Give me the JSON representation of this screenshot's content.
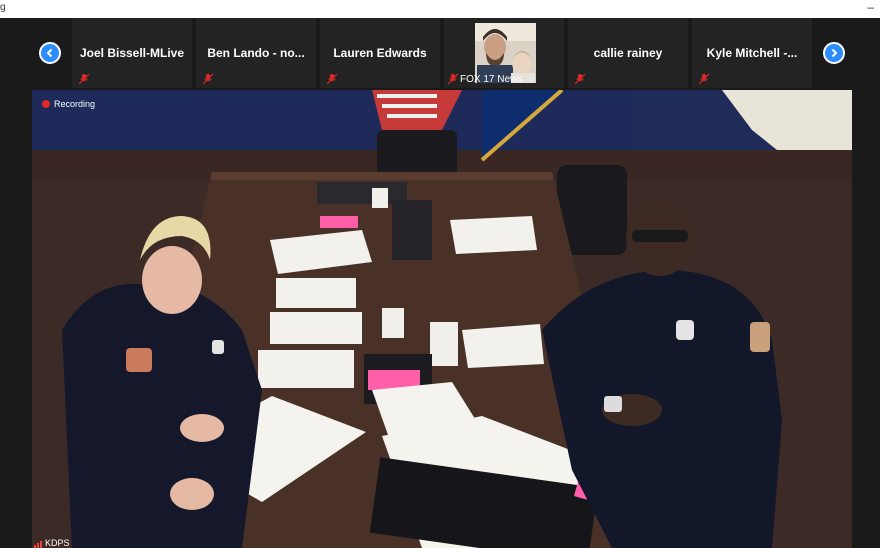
{
  "window": {
    "title": "g",
    "minimize_glyph": "–"
  },
  "strip": {
    "participants": [
      {
        "name": "Joel Bissell-MLive",
        "muted": true
      },
      {
        "name": "Ben Lando - no...",
        "muted": true
      },
      {
        "name": "Lauren Edwards",
        "muted": true
      },
      {
        "name": "FOX 17 News",
        "muted": true,
        "video": true
      },
      {
        "name": "callie rainey",
        "muted": true
      },
      {
        "name": "Kyle  Mitchell -...",
        "muted": true
      }
    ],
    "prev_icon": "chevron-left-icon",
    "next_icon": "chevron-right-icon"
  },
  "main": {
    "recording_label": "Recording",
    "speaker_name": "KDPS"
  },
  "colors": {
    "accent": "#2d8cff",
    "muted_red": "#e02828"
  }
}
